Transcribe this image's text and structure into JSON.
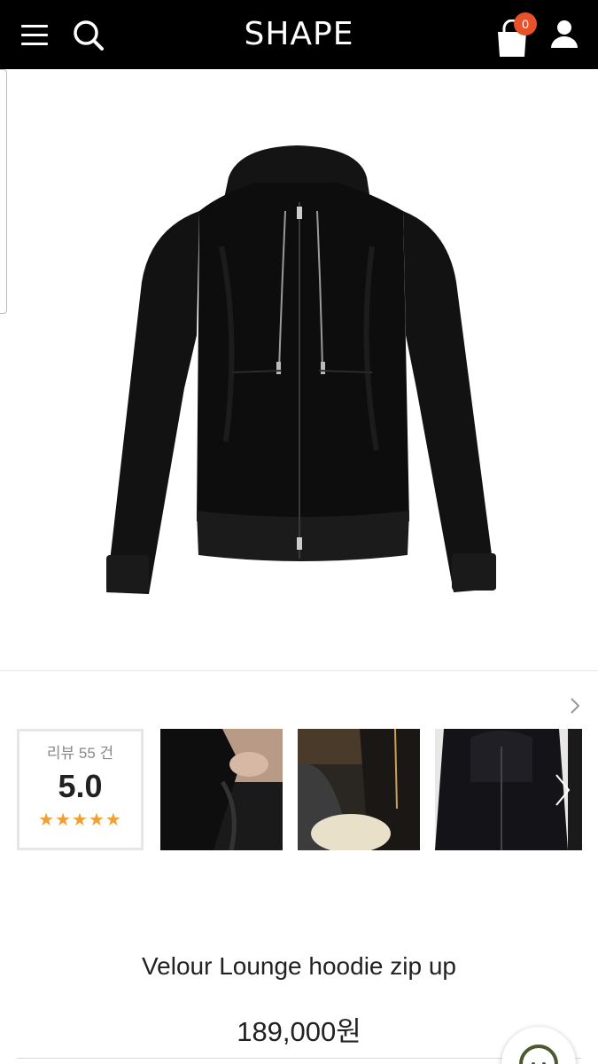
{
  "header": {
    "logo": "SHAPE",
    "cart_count": "0",
    "icons": [
      "menu-icon",
      "search-icon",
      "shopping-bag-icon",
      "user-icon"
    ],
    "background_color": "#000000",
    "badge_color": "#e8512a"
  },
  "product_image": {
    "alt": "Velour Lounge hoodie zip up"
  },
  "reviews": {
    "label": "리뷰 55 건",
    "score": "5.0",
    "stars": "★★★★★",
    "star_count": 5,
    "star_color": "#f0a030"
  },
  "product": {
    "name": "Velour Lounge hoodie zip up",
    "price": "189,000원"
  }
}
